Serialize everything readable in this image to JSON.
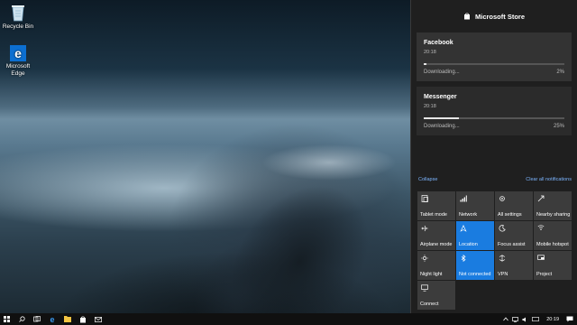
{
  "desktop": {
    "icons": [
      {
        "label": "Recycle Bin",
        "icon": "recycle-bin-icon"
      },
      {
        "label": "Microsoft Edge",
        "icon": "edge-icon"
      }
    ]
  },
  "action_center": {
    "header": {
      "title": "Microsoft Store",
      "icon": "store-icon"
    },
    "notifications": [
      {
        "app": "Facebook",
        "time": "20:18",
        "status": "Downloading...",
        "percent_label": "2%",
        "progress": 0.02
      },
      {
        "app": "Messenger",
        "time": "20:18",
        "status": "Downloading...",
        "percent_label": "25%",
        "progress": 0.25
      }
    ],
    "collapse_label": "Collapse",
    "clear_all_label": "Clear all notifications",
    "quick_actions": [
      {
        "label": "Tablet mode",
        "icon": "tablet-mode-icon",
        "active": false
      },
      {
        "label": "Network",
        "icon": "network-icon",
        "active": false
      },
      {
        "label": "All settings",
        "icon": "gear-icon",
        "active": false
      },
      {
        "label": "Nearby sharing",
        "icon": "nearby-sharing-icon",
        "active": false
      },
      {
        "label": "Airplane mode",
        "icon": "airplane-icon",
        "active": false
      },
      {
        "label": "Location",
        "icon": "location-icon",
        "active": true
      },
      {
        "label": "Focus assist",
        "icon": "moon-icon",
        "active": false
      },
      {
        "label": "Mobile hotspot",
        "icon": "hotspot-icon",
        "active": false
      },
      {
        "label": "Night light",
        "icon": "sun-icon",
        "active": false
      },
      {
        "label": "Not connected",
        "icon": "bluetooth-icon",
        "active": true
      },
      {
        "label": "VPN",
        "icon": "vpn-icon",
        "active": false
      },
      {
        "label": "Project",
        "icon": "project-icon",
        "active": false
      },
      {
        "label": "Connect",
        "icon": "connect-icon",
        "active": false
      }
    ]
  },
  "taskbar": {
    "buttons": [
      "start-icon",
      "search-icon",
      "task-view-icon",
      "edge-icon",
      "file-explorer-icon",
      "store-icon",
      "mail-icon"
    ],
    "clock": "20:19",
    "accent": "#1a7ce0"
  }
}
